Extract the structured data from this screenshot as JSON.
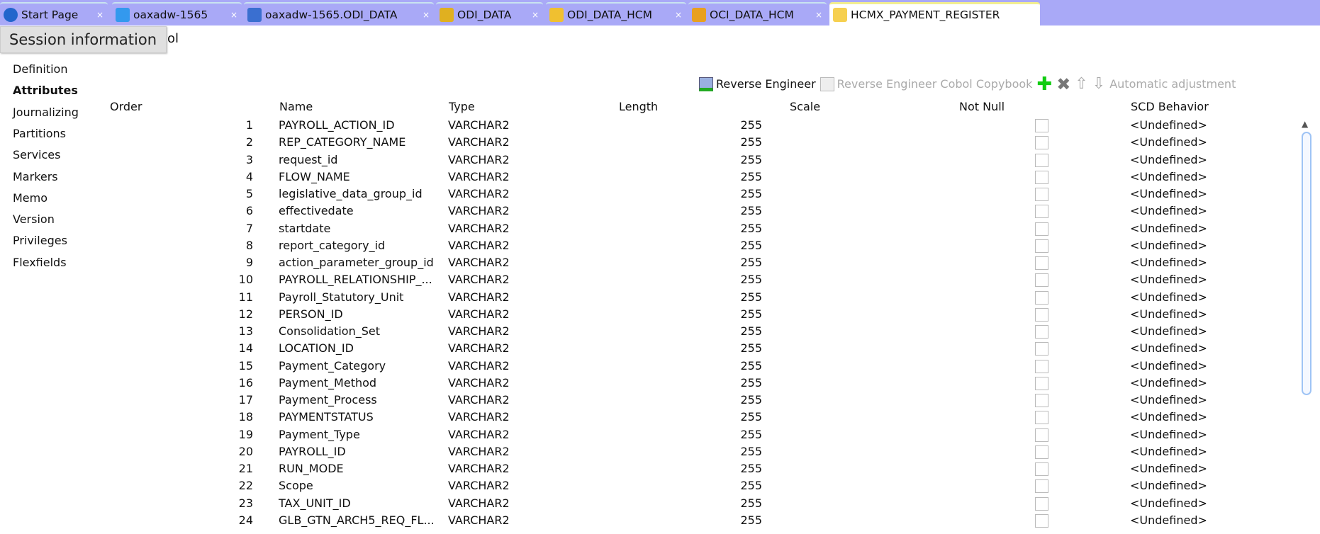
{
  "tabs": [
    {
      "label": "Start Page",
      "icon": "help-icon",
      "color": "#2266cc"
    },
    {
      "label": "oaxadw-1565",
      "icon": "database-icon",
      "color": "#3399ee"
    },
    {
      "label": "oaxadw-1565.ODI_DATA",
      "icon": "schema-icon",
      "color": "#3a6fd0"
    },
    {
      "label": "ODI_DATA",
      "icon": "model-icon",
      "color": "#e0b020"
    },
    {
      "label": "ODI_DATA_HCM",
      "icon": "datastore-folder-icon",
      "color": "#f0c030"
    },
    {
      "label": "OCI_DATA_HCM",
      "icon": "model-diagram-icon",
      "color": "#e8a020"
    },
    {
      "label": "HCMX_PAYMENT_REGISTER",
      "icon": "datastore-icon",
      "color": "#f6d050"
    }
  ],
  "close_glyph": "×",
  "tooltip": "Session information",
  "under_tooltip": "ol",
  "sidebar": [
    "Definition",
    "Attributes",
    "Journalizing",
    "Partitions",
    "Services",
    "Markers",
    "Memo",
    "Version",
    "Privileges",
    "Flexfields"
  ],
  "toolbar": {
    "reverse": "Reverse Engineer",
    "cobol": "Reverse Engineer Cobol Copybook",
    "auto": "Automatic adjustment"
  },
  "columns": [
    "Order",
    "Name",
    "Type",
    "Length",
    "Scale",
    "Not Null",
    "SCD Behavior"
  ],
  "rows": [
    [
      "1",
      "PAYROLL_ACTION_ID"
    ],
    [
      "2",
      "REP_CATEGORY_NAME"
    ],
    [
      "3",
      "request_id"
    ],
    [
      "4",
      "FLOW_NAME"
    ],
    [
      "5",
      "legislative_data_group_id"
    ],
    [
      "6",
      "effectivedate"
    ],
    [
      "7",
      "startdate"
    ],
    [
      "8",
      "report_category_id"
    ],
    [
      "9",
      "action_parameter_group_id"
    ],
    [
      "10",
      "PAYROLL_RELATIONSHIP_..."
    ],
    [
      "11",
      "Payroll_Statutory_Unit"
    ],
    [
      "12",
      "PERSON_ID"
    ],
    [
      "13",
      "Consolidation_Set"
    ],
    [
      "14",
      "LOCATION_ID"
    ],
    [
      "15",
      "Payment_Category"
    ],
    [
      "16",
      "Payment_Method"
    ],
    [
      "17",
      "Payment_Process"
    ],
    [
      "18",
      "PAYMENTSTATUS"
    ],
    [
      "19",
      "Payment_Type"
    ],
    [
      "20",
      "PAYROLL_ID"
    ],
    [
      "21",
      "RUN_MODE"
    ],
    [
      "22",
      "Scope"
    ],
    [
      "23",
      "TAX_UNIT_ID"
    ],
    [
      "24",
      "GLB_GTN_ARCH5_REQ_FL..."
    ]
  ],
  "row_type": "VARCHAR2",
  "row_scale": "255",
  "row_scd": "<Undefined>"
}
